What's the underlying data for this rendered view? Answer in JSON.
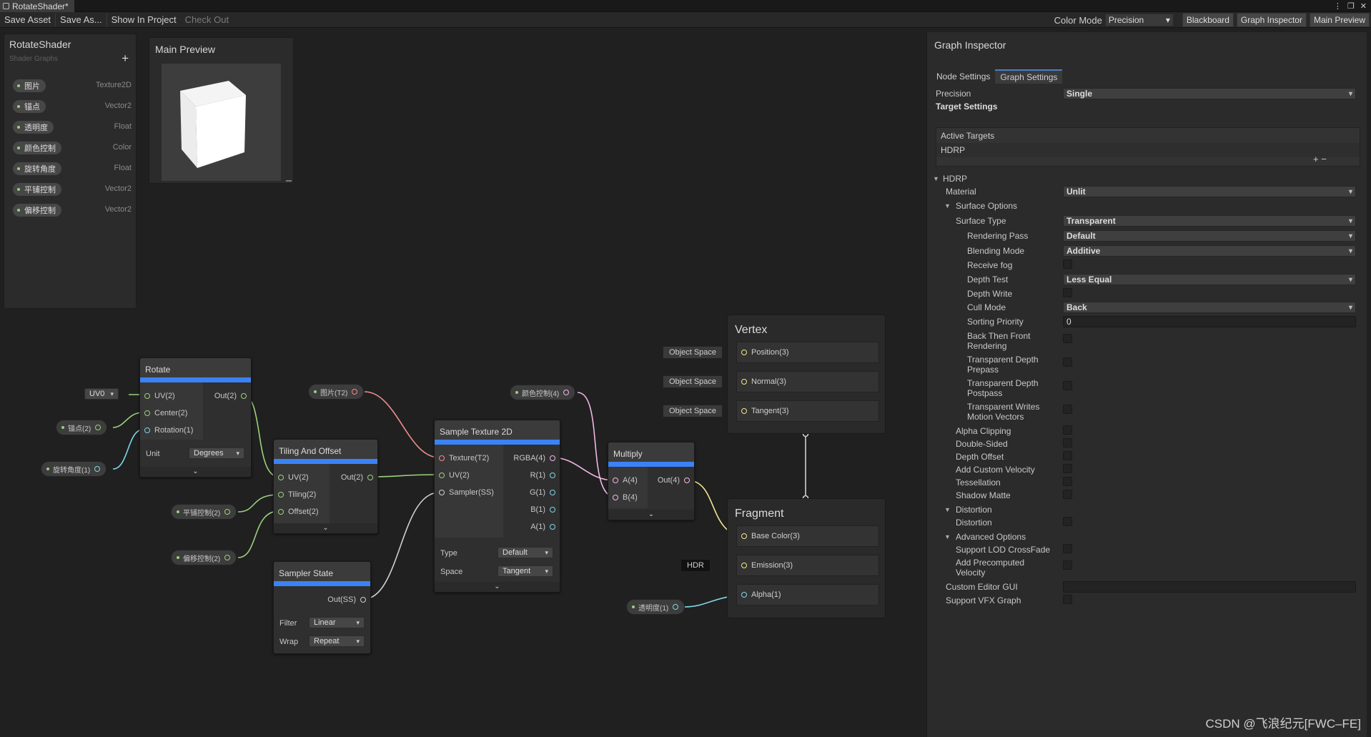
{
  "window": {
    "tab_title": "RotateShader*"
  },
  "toolbar": {
    "save_asset": "Save Asset",
    "save_as": "Save As...",
    "show_in_project": "Show In Project",
    "check_out": "Check Out",
    "color_mode_label": "Color Mode",
    "color_mode_value": "Precision",
    "blackboard": "Blackboard",
    "graph_inspector": "Graph Inspector",
    "main_preview": "Main Preview"
  },
  "blackboard": {
    "title": "RotateShader",
    "subtitle": "Shader Graphs",
    "add_symbol": "+",
    "properties": [
      {
        "name": "图片",
        "type": "Texture2D"
      },
      {
        "name": "锚点",
        "type": "Vector2"
      },
      {
        "name": "透明度",
        "type": "Float"
      },
      {
        "name": "颜色控制",
        "type": "Color"
      },
      {
        "name": "旋转角度",
        "type": "Float"
      },
      {
        "name": "平铺控制",
        "type": "Vector2"
      },
      {
        "name": "偏移控制",
        "type": "Vector2"
      }
    ]
  },
  "preview": {
    "title": "Main Preview"
  },
  "nodes": {
    "rotate": {
      "title": "Rotate",
      "in_uv": "UV(2)",
      "in_center": "Center(2)",
      "in_rotation": "Rotation(1)",
      "out": "Out(2)",
      "unit_label": "Unit",
      "unit_value": "Degrees",
      "uv_channel": "UV0"
    },
    "tiling": {
      "title": "Tiling And Offset",
      "in_uv": "UV(2)",
      "in_tiling": "Tiling(2)",
      "in_offset": "Offset(2)",
      "out": "Out(2)"
    },
    "sampler": {
      "title": "Sampler State",
      "out": "Out(SS)",
      "filter_label": "Filter",
      "filter_value": "Linear",
      "wrap_label": "Wrap",
      "wrap_value": "Repeat"
    },
    "sample": {
      "title": "Sample Texture 2D",
      "in_tex": "Texture(T2)",
      "in_uv": "UV(2)",
      "in_sampler": "Sampler(SS)",
      "out_rgba": "RGBA(4)",
      "out_r": "R(1)",
      "out_g": "G(1)",
      "out_b": "B(1)",
      "out_a": "A(1)",
      "type_label": "Type",
      "type_value": "Default",
      "space_label": "Space",
      "space_value": "Tangent"
    },
    "multiply": {
      "title": "Multiply",
      "in_a": "A(4)",
      "in_b": "B(4)",
      "out": "Out(4)"
    }
  },
  "graph_pills": {
    "anchor": "锚点(2)",
    "angle": "旋转角度(1)",
    "tiling": "平铺控制(2)",
    "offset": "偏移控制(2)",
    "image": "图片(T2)",
    "color": "颜色控制(4)",
    "alpha": "透明度(1)"
  },
  "master": {
    "vertex_title": "Vertex",
    "object_space": "Object Space",
    "position": "Position(3)",
    "normal": "Normal(3)",
    "tangent": "Tangent(3)",
    "fragment_title": "Fragment",
    "base_color": "Base Color(3)",
    "emission": "Emission(3)",
    "hdr": "HDR",
    "alpha": "Alpha(1)"
  },
  "inspector": {
    "title": "Graph Inspector",
    "tabs": [
      "Node Settings",
      "Graph Settings"
    ],
    "precision_label": "Precision",
    "precision_value": "Single",
    "target_settings": "Target Settings",
    "active_targets": "Active Targets",
    "target_item": "HDRP",
    "add_remove": "+  −",
    "hdrp_header": "HDRP",
    "material_label": "Material",
    "material_value": "Unlit",
    "surface_options": "Surface Options",
    "surface_type_label": "Surface Type",
    "surface_type_value": "Transparent",
    "rendering_pass_label": "Rendering Pass",
    "rendering_pass_value": "Default",
    "blending_mode_label": "Blending Mode",
    "blending_mode_value": "Additive",
    "receive_fog": "Receive fog",
    "depth_test_label": "Depth Test",
    "depth_test_value": "Less Equal",
    "depth_write": "Depth Write",
    "cull_mode_label": "Cull Mode",
    "cull_mode_value": "Back",
    "sorting_priority_label": "Sorting Priority",
    "sorting_priority_value": "0",
    "back_then_front_1": "Back Then Front",
    "back_then_front_2": "Rendering",
    "tdp_1": "Transparent Depth",
    "tdp_2": "Prepass",
    "tdpost_1": "Transparent Depth",
    "tdpost_2": "Postpass",
    "twmv_1": "Transparent Writes",
    "twmv_2": "Motion Vectors",
    "alpha_clipping": "Alpha Clipping",
    "double_sided": "Double-Sided",
    "depth_offset": "Depth Offset",
    "custom_velocity": "Add Custom Velocity",
    "tessellation": "Tessellation",
    "shadow_matte": "Shadow Matte",
    "distortion_header": "Distortion",
    "distortion": "Distortion",
    "advanced_options": "Advanced Options",
    "lod_crossfade": "Support LOD CrossFade",
    "precomputed_1": "Add Precomputed",
    "precomputed_2": "Velocity",
    "custom_editor_gui": "Custom Editor GUI",
    "vfx_graph": "Support VFX Graph"
  },
  "watermark": "CSDN @飞浪纪元[FWC–FE]",
  "colors": {
    "accent_blue": "#3b82f6",
    "wire_vector2": "#9bd17c",
    "wire_vector1": "#7fd6e6",
    "wire_texture": "#f08c8c",
    "wire_vector4": "#f2b6e6",
    "wire_vector3": "#f2e88a",
    "wire_sampler": "#cfcfcf"
  }
}
